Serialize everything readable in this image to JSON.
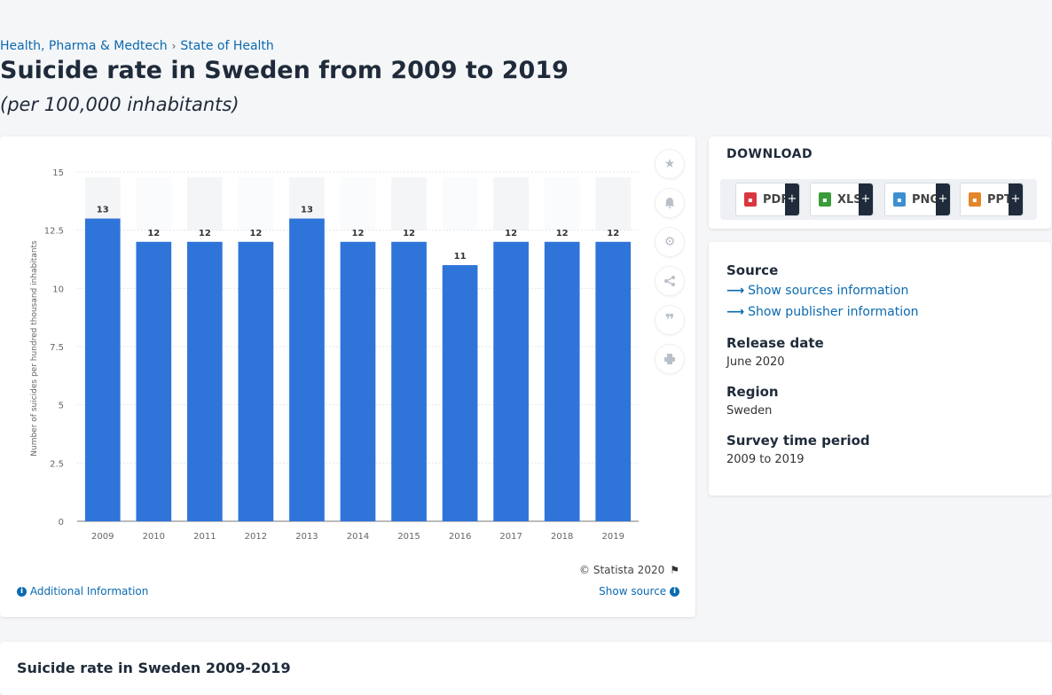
{
  "breadcrumb": {
    "items": [
      "Health, Pharma & Medtech",
      "State of Health"
    ],
    "separator": "›"
  },
  "page": {
    "title": "Suicide rate in Sweden from 2009 to 2019",
    "subtitle": "(per 100,000 inhabitants)"
  },
  "chart_data": {
    "type": "bar",
    "categories": [
      "2009",
      "2010",
      "2011",
      "2012",
      "2013",
      "2014",
      "2015",
      "2016",
      "2017",
      "2018",
      "2019"
    ],
    "values": [
      13,
      12,
      12,
      12,
      13,
      12,
      12,
      11,
      12,
      12,
      12
    ],
    "data_labels": [
      "13",
      "12",
      "12",
      "12",
      "13",
      "12",
      "12",
      "11",
      "12",
      "12",
      "12"
    ],
    "ylabel": "Number of suicides per hundred thousand inhabitants",
    "ylim": [
      0,
      15
    ],
    "yticks": [
      0,
      2.5,
      5,
      7.5,
      10,
      12.5,
      15
    ],
    "ytick_labels": [
      "0",
      "2.5",
      "5",
      "7.5",
      "10",
      "12.5",
      "15"
    ],
    "bar_color": "#2f74d9",
    "grid": true,
    "legend": "none"
  },
  "chart_footer": {
    "copyright": "© Statista 2020",
    "additional_info": "Additional Information",
    "show_source": "Show source"
  },
  "tools": [
    "star-icon",
    "bell-icon",
    "gear-icon",
    "share-icon",
    "quote-icon",
    "print-icon"
  ],
  "download": {
    "title": "DOWNLOAD",
    "buttons": [
      {
        "label": "PDF",
        "icon": "pdf-file-icon",
        "color": "#d9363e"
      },
      {
        "label": "XLS",
        "icon": "xls-file-icon",
        "color": "#3a9b3a"
      },
      {
        "label": "PNG",
        "icon": "png-file-icon",
        "color": "#3d8fd1"
      },
      {
        "label": "PPT",
        "icon": "ppt-file-icon",
        "color": "#e3862a"
      }
    ],
    "plus": "+"
  },
  "meta": {
    "source_label": "Source",
    "show_sources": "Show sources information",
    "show_publisher": "Show publisher information",
    "release_label": "Release date",
    "release_value": "June 2020",
    "region_label": "Region",
    "region_value": "Sweden",
    "period_label": "Survey time period",
    "period_value": "2009 to 2019"
  },
  "bottom": {
    "title": "Suicide rate in Sweden 2009-2019"
  }
}
